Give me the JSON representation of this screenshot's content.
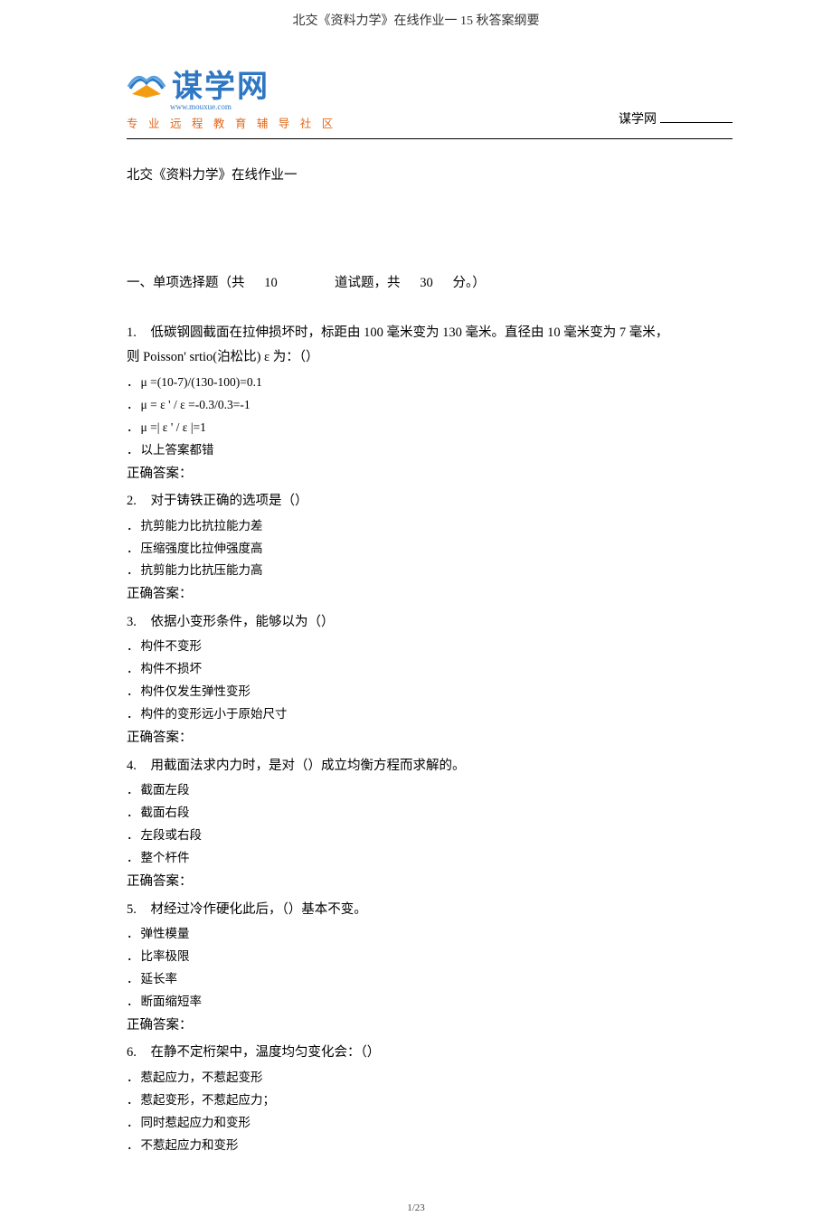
{
  "header_title": "北交《资料力学》在线作业一 15 秋答案纲要",
  "logo": {
    "text": "谋学网",
    "url": "www.mouxue.com",
    "subtitle": "专 业 远 程 教 育 辅 导 社 区",
    "right_label": "谋学网"
  },
  "doc_title": "北交《资料力学》在线作业一",
  "section1": {
    "prefix": "一、单项选择题（共",
    "count": "10",
    "mid": "道试题，共",
    "score": "30",
    "suffix": "分。）"
  },
  "questions": [
    {
      "num": "1.",
      "stem": "低碳钢圆截面在拉伸损坏时，标距由 100 毫米变为 130 毫米。直径由 10 毫米变为 7 毫米，",
      "stem2": "则 Poisson' srtio(泊松比) ε 为：（）",
      "options": [
        "μ =(10-7)/(130-100)=0.1",
        "μ = ε ' / ε =-0.3/0.3=-1",
        "μ =| ε ' / ε |=1",
        "以上答案都错"
      ],
      "ans_label": "正确答案："
    },
    {
      "num": "2.",
      "stem": "对于铸铁正确的选项是（）",
      "options": [
        "抗剪能力比抗拉能力差",
        "压缩强度比拉伸强度高",
        "抗剪能力比抗压能力高"
      ],
      "ans_label": "正确答案："
    },
    {
      "num": "3.",
      "stem": "依据小变形条件，能够以为（）",
      "options": [
        "构件不变形",
        "构件不损坏",
        "构件仅发生弹性变形",
        "构件的变形远小于原始尺寸"
      ],
      "ans_label": "正确答案："
    },
    {
      "num": "4.",
      "stem": "用截面法求内力时，是对（）成立均衡方程而求解的。",
      "options": [
        "截面左段",
        "截面右段",
        "左段或右段",
        "整个杆件"
      ],
      "ans_label": "正确答案："
    },
    {
      "num": "5.",
      "stem": "材经过冷作硬化此后，（）基本不变。",
      "options": [
        "弹性模量",
        "比率极限",
        "延长率",
        "断面缩短率"
      ],
      "ans_label": "正确答案："
    },
    {
      "num": "6.",
      "stem": "在静不定桁架中，温度均匀变化会：（）",
      "options": [
        "惹起应力，不惹起变形",
        "惹起变形，不惹起应力；",
        "同时惹起应力和变形",
        "不惹起应力和变形"
      ],
      "ans_label": ""
    }
  ],
  "footer": "1/23"
}
